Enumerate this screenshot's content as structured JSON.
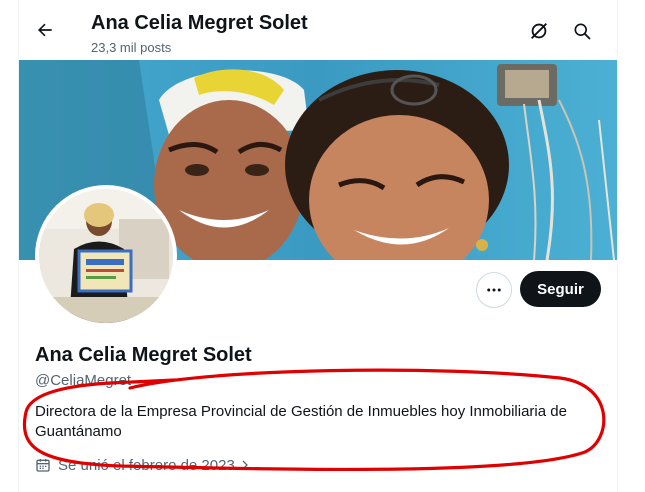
{
  "header": {
    "title": "Ana Celia Megret Solet",
    "posts_count": "23,3 mil posts",
    "icons": [
      "back-arrow-icon",
      "grok-icon",
      "search-icon"
    ]
  },
  "profile": {
    "name": "Ana Celia Megret Solet",
    "handle": "@CeliaMegret",
    "bio": "Directora de la Empresa Provincial de Gestión de Inmuebles hoy Inmobiliaria de Guantánamo",
    "joined": "Se unió el febrero de 2023",
    "follow_label": "Seguir"
  },
  "colors": {
    "annotation": "#e00000",
    "text_primary": "#0f1419",
    "text_secondary": "#536471",
    "button_dark": "#0f1419",
    "banner_wall": "#3fa1c6"
  }
}
